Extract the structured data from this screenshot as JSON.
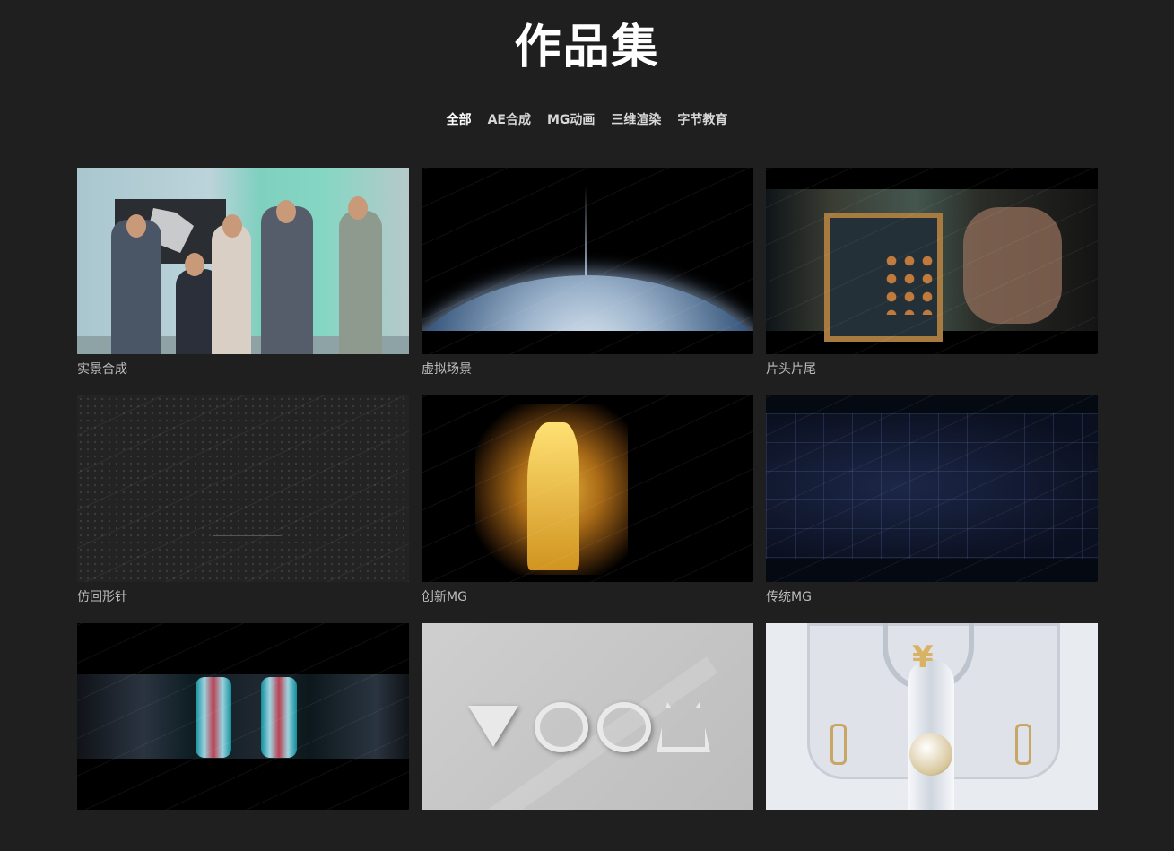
{
  "page": {
    "title": "作品集"
  },
  "filters": [
    {
      "label": "全部",
      "active": true
    },
    {
      "label": "AE合成",
      "active": false
    },
    {
      "label": "MG动画",
      "active": false
    },
    {
      "label": "三维渲染",
      "active": false
    },
    {
      "label": "字节教育",
      "active": false
    }
  ],
  "works": [
    {
      "caption": "实景合成"
    },
    {
      "caption": "虚拟场景"
    },
    {
      "caption": "片头片尾"
    },
    {
      "caption": "仿回形针"
    },
    {
      "caption": "创新MG"
    },
    {
      "caption": "传统MG"
    },
    {
      "caption": ""
    },
    {
      "caption": ""
    },
    {
      "caption": ""
    }
  ],
  "thumbnails": {
    "voom_word": "VOOM",
    "yen_symbol": "¥"
  },
  "colors": {
    "background": "#1f1f1f",
    "title": "#ffffff",
    "caption": "#bdbdbd"
  }
}
